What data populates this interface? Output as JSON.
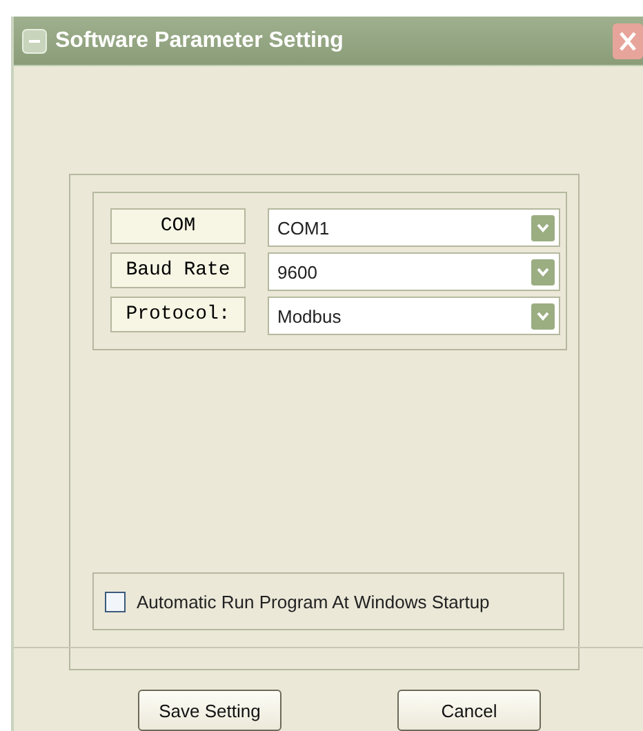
{
  "window": {
    "title": "Software Parameter Setting"
  },
  "fields": [
    {
      "label": "COM",
      "value": "COM1"
    },
    {
      "label": "Baud Rate",
      "value": "9600"
    },
    {
      "label": "Protocol:",
      "value": "Modbus"
    }
  ],
  "startup_option": {
    "label": "Automatic Run Program At Windows Startup",
    "checked": false
  },
  "buttons": [
    "Save Setting",
    "Cancel"
  ]
}
